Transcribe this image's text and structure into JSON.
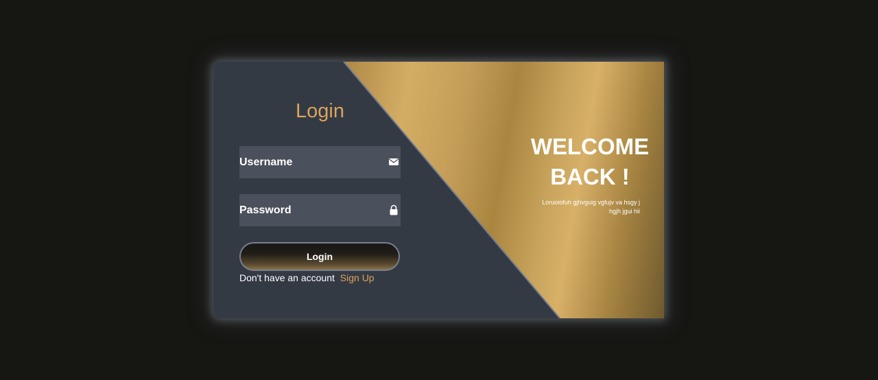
{
  "login_form": {
    "title": "Login",
    "username_placeholder": "Username",
    "password_placeholder": "Password",
    "username_icon": "envelope-icon",
    "password_icon": "lock-icon",
    "submit_label": "Login",
    "signup_prompt": "Don't have an account",
    "signup_link": "Sign Up"
  },
  "welcome_panel": {
    "heading": "WELCOME BACK !",
    "subtext": "Loruoiofuh gjhvguig vgfujv va hsgy j hgjh jgui hii"
  },
  "colors": {
    "page_background": "#161613",
    "card_background": "#343a44",
    "accent_gold": "#d9a45b",
    "field_background": "#4a515c"
  }
}
